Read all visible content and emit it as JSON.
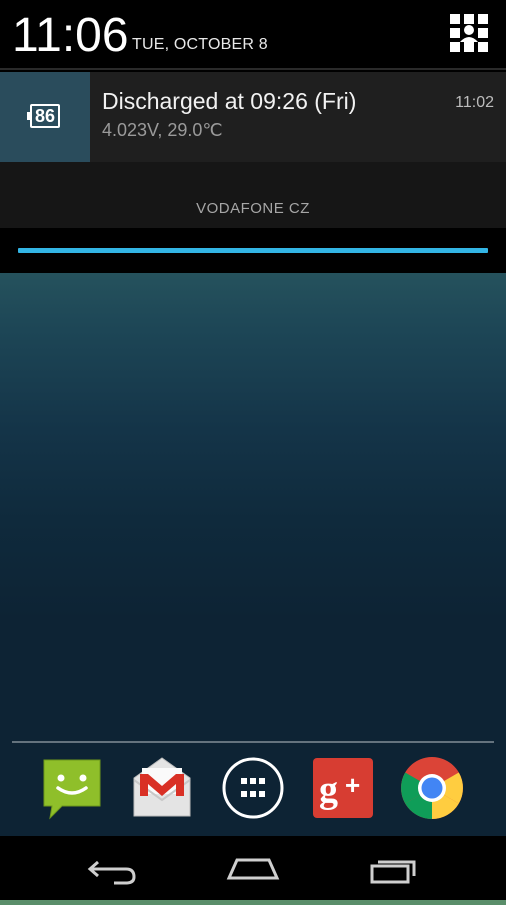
{
  "status": {
    "time": "11:06",
    "date": "TUE, OCTOBER 8"
  },
  "notification": {
    "battery_level": "86",
    "title": "Discharged at 09:26 (Fri)",
    "detail": "4.023V, 29.0℃",
    "time": "11:02"
  },
  "carrier": "VODAFONE CZ",
  "colors": {
    "accent": "#33b5e5",
    "notification_icon_bg": "#2a4c5c"
  },
  "dock": {
    "apps": [
      "messaging-icon",
      "gmail-icon",
      "app-drawer-icon",
      "google-plus-icon",
      "chrome-icon"
    ]
  },
  "navbar": {
    "buttons": [
      "back-icon",
      "home-icon",
      "recents-icon"
    ]
  }
}
